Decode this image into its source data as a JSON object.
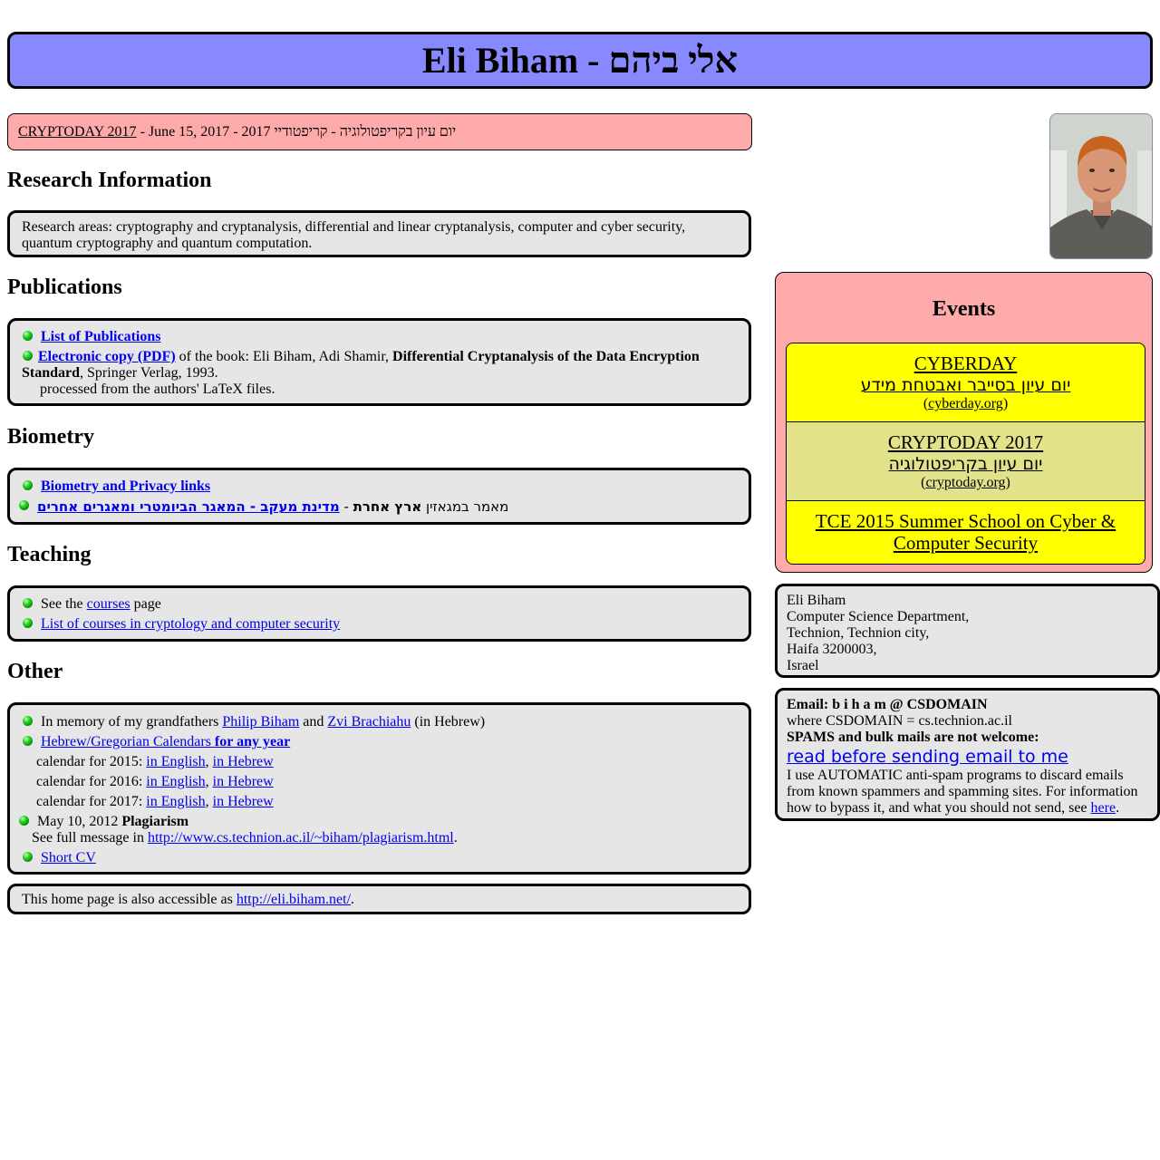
{
  "header": {
    "title": "Eli Biham - אלי ביהם"
  },
  "announcement": {
    "link": "CRYPTODAY 2017",
    "text": " - June 15, 2017 - 2017 יום עיון בקריפטולוגיה - קריפטודיי"
  },
  "research": {
    "heading": "Research Information",
    "text": "Research areas: cryptography and cryptanalysis, differential and linear cryptanalysis, computer and cyber security, quantum cryptography and quantum computation."
  },
  "publications": {
    "heading": "Publications",
    "list_link": "List of Publications",
    "ecopy_link": "Electronic copy (PDF)",
    "ecopy_text": " of the book: Eli Biham, Adi Shamir, ",
    "book_title": "Differential Cryptanalysis of the Data Encryption Standard",
    "publisher": ", Springer Verlag, 1993.",
    "note": "processed from the authors' LaTeX files."
  },
  "biometry": {
    "heading": "Biometry",
    "links": "Biometry and Privacy links",
    "article_prefix": "מאמר במגאזין ",
    "article_magazine": "ארץ אחרת",
    "article_sep": " - ",
    "article_link": "מדינת מעקב - המאגר הביומטרי ומאגרים אחרים"
  },
  "teaching": {
    "heading": "Teaching",
    "see_the": "See the ",
    "courses_link": "courses",
    "page": " page",
    "list_link": "List of courses in cryptology and computer security"
  },
  "other": {
    "heading": "Other",
    "memory_prefix": "In memory of my grandfathers ",
    "philip": "Philip Biham",
    "and": " and ",
    "zvi": "Zvi Brachiahu",
    "memory_suffix": " (in Hebrew)",
    "calendars_link": "Hebrew/Gregorian Calendars",
    "calendars_bold": " for any year",
    "calendars": [
      {
        "label": "calendar for 2015: ",
        "en": "in English",
        "sep": ", ",
        "he": "in Hebrew"
      },
      {
        "label": "calendar for 2016: ",
        "en": "in English",
        "sep": ", ",
        "he": "in Hebrew"
      },
      {
        "label": "calendar for 2017: ",
        "en": "in English",
        "sep": ", ",
        "he": "in Hebrew"
      }
    ],
    "plag_date": "May 10, 2012 ",
    "plag_title": "Plagiarism",
    "plag_prefix": "See full message in ",
    "plag_link": "http://www.cs.technion.ac.il/~biham/plagiarism.html",
    "plag_suffix": ".",
    "cv_link": "Short CV"
  },
  "footer": {
    "prefix": "This home page is also accessible as ",
    "link": "http://eli.biham.net/",
    "suffix": "."
  },
  "events": {
    "heading": "Events",
    "items": [
      {
        "title": "CYBERDAY",
        "subtitle": "יום עיון בסייבר ואבטחת מידע",
        "open": "(",
        "site": "cyberday.org",
        "close": ")",
        "color": "#ffff00"
      },
      {
        "title": "CRYPTODAY 2017",
        "subtitle": "יום עיון בקריפטולוגיה",
        "open": "(",
        "site": "cryptoday.org",
        "close": ")",
        "color": "#e2e28a"
      },
      {
        "title": "TCE 2015 Summer School on Cyber & Computer Security",
        "color": "#ffff00"
      }
    ]
  },
  "address": {
    "lines": [
      "Eli Biham",
      "Computer Science Department,",
      "Technion, Technion city,",
      "Haifa 3200003,",
      "Israel"
    ]
  },
  "contact": {
    "email": "Email: b i h a m @ CSDOMAIN",
    "where": "where CSDOMAIN = cs.technion.ac.il",
    "spam": "SPAMS and bulk mails are not welcome:",
    "read_link": "read before sending email to me",
    "info": "I use AUTOMATIC anti-spam programs to discard emails from known spammers and spamming sites. For information how to bypass it, and what you should not send, see ",
    "here": "here",
    "end": "."
  },
  "colors": {
    "title_bg": "#8888ff",
    "announcement_bg": "#ffaaaa",
    "box_bg": "#e6e6e6",
    "event_yellow": "#ffff00",
    "event_olive": "#e2e28a",
    "link": "#0000ee"
  },
  "icons": {
    "bullet": "green-ball-icon",
    "photo": "portrait-photo"
  }
}
